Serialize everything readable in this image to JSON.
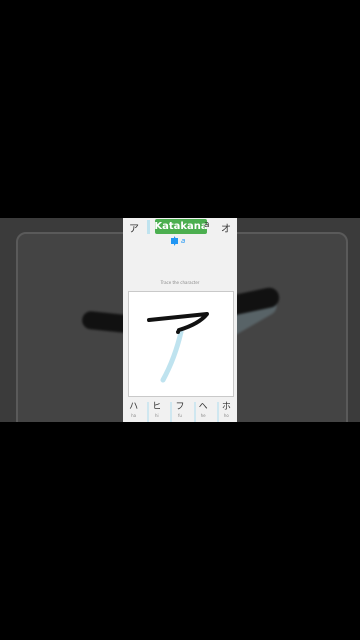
{
  "header": {
    "title": "Katakana",
    "left_kana": "ア",
    "right_kana": "オ",
    "hidden_kana": "a"
  },
  "audio": {
    "romaji": "a"
  },
  "instruction": "Trace the character",
  "colors": {
    "accent": "#4caf50",
    "guide": "#bfe3ef",
    "ink": "#111111"
  },
  "bottom_row": [
    {
      "kana": "ハ",
      "romaji": "ha"
    },
    {
      "kana": "ヒ",
      "romaji": "hi"
    },
    {
      "kana": "フ",
      "romaji": "fu"
    },
    {
      "kana": "ヘ",
      "romaji": "he"
    },
    {
      "kana": "ホ",
      "romaji": "ho"
    }
  ]
}
